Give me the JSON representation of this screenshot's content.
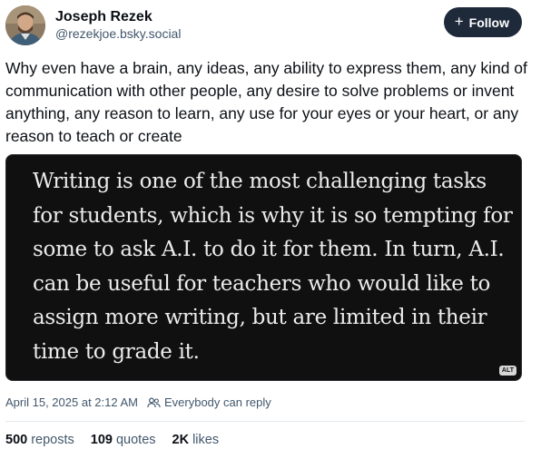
{
  "author": {
    "display_name": "Joseph Rezek",
    "handle": "@rezekjoe.bsky.social"
  },
  "follow_button": {
    "icon": "+",
    "label": "Follow"
  },
  "post": {
    "text": "Why even have a brain, any ideas, any ability to express them, any kind of communication with other people, any desire to solve problems or invent anything, any reason to learn, any use for your eyes or your heart, or any reason to teach or create"
  },
  "image": {
    "text": "Writing is one of the most challenging tasks for students, which is why it is so tempting for some to ask A.I. to do it for them. In turn, A.I. can be useful for teachers who would like to assign more writing, but are limited in their time to grade it.",
    "alt_badge": "ALT"
  },
  "meta": {
    "timestamp": "April 15, 2025 at 2:12 AM",
    "reply_setting": "Everybody can reply"
  },
  "stats": {
    "reposts_count": "500",
    "reposts_label": "reposts",
    "quotes_count": "109",
    "quotes_label": "quotes",
    "likes_count": "2K",
    "likes_label": "likes"
  },
  "colors": {
    "follow_button_bg": "#1e2a3a",
    "image_bg": "#101010",
    "muted_text": "#42576c"
  },
  "icons": {
    "reply_setting": "people-icon",
    "follow": "plus-icon"
  }
}
